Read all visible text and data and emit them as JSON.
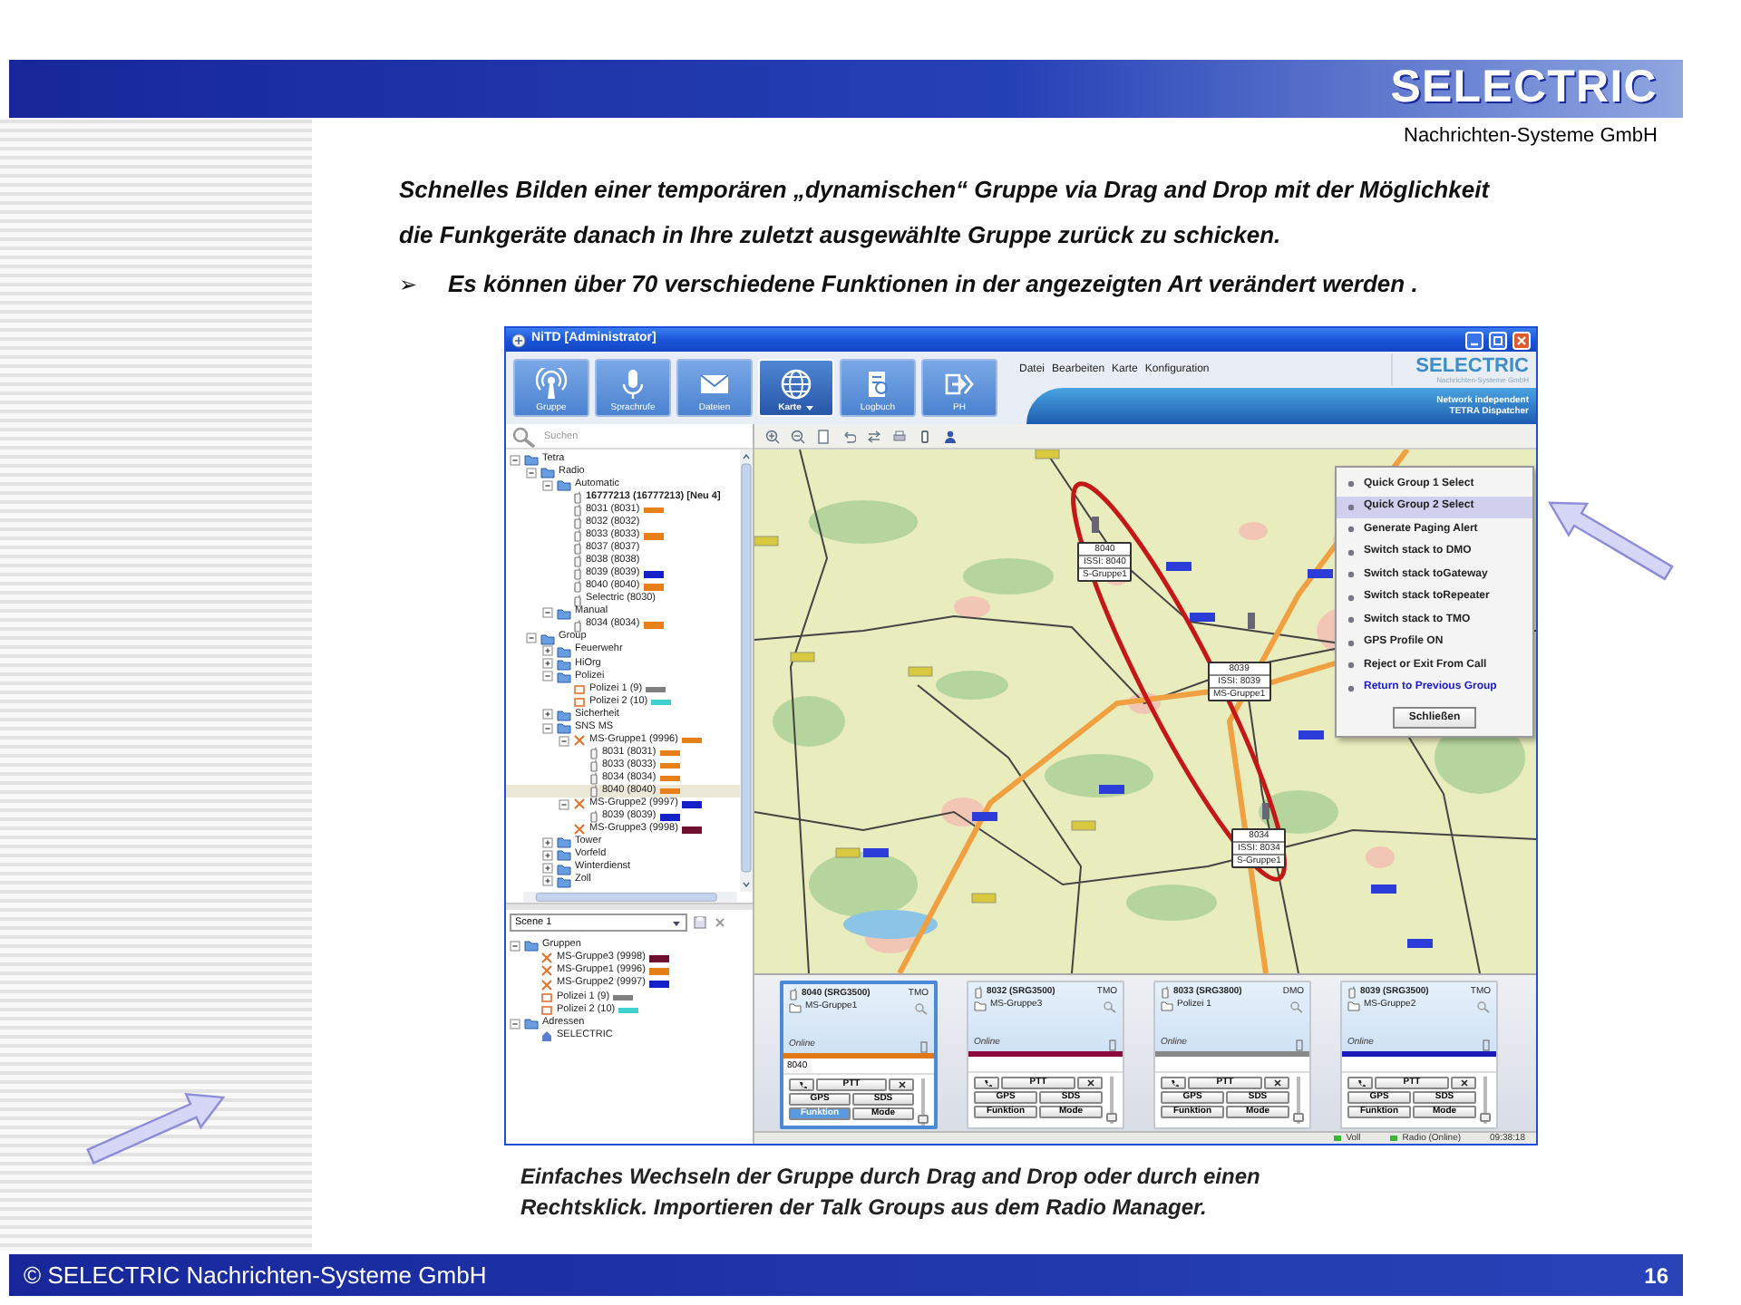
{
  "header": {
    "logo": "SELECTRIC",
    "tagline": "Nachrichten-Systeme GmbH"
  },
  "intro": {
    "lines": [
      "Schnelles Bilden einer temporären „dynamischen“ Gruppe via Drag and Drop mit der Möglichkeit",
      "die Funkgeräte danach in Ihre zuletzt ausgewählte Gruppe zurück zu schicken."
    ]
  },
  "bullet": {
    "marker": "➢",
    "text": "Es können über 70 verschiedene Funktionen in der angezeigten Art verändert werden ."
  },
  "app": {
    "title": "NiTD [Administrator]",
    "toolbar": [
      {
        "kind": "group",
        "label": "Gruppe",
        "selected": false,
        "has_menu": false
      },
      {
        "kind": "voice",
        "label": "Sprachrufe",
        "selected": false,
        "has_menu": false
      },
      {
        "kind": "files",
        "label": "Dateien",
        "selected": false,
        "has_menu": false
      },
      {
        "kind": "map",
        "label": "Karte",
        "selected": true,
        "has_menu": true
      },
      {
        "kind": "log",
        "label": "Logbuch",
        "selected": false,
        "has_menu": false
      },
      {
        "kind": "ph",
        "label": "PH",
        "selected": false,
        "has_menu": false
      }
    ],
    "menu": [
      "Datei",
      "Bearbeiten",
      "Karte",
      "Konfiguration"
    ],
    "logo": {
      "name": "SELECTRIC",
      "subtitle": "Nachrichten-Systeme GmbH",
      "tagline": [
        "Network independent",
        "TETRA Dispatcher"
      ]
    },
    "search": {
      "placeholder": "Suchen"
    },
    "tree": [
      {
        "kind": "folder",
        "label": "Tetra",
        "expanded": true,
        "selected": false,
        "children": [
          {
            "kind": "folder",
            "label": "Radio",
            "expanded": true,
            "selected": false,
            "children": [
              {
                "kind": "folder",
                "label": "Automatic",
                "expanded": true,
                "selected": false,
                "children": [
                  {
                    "kind": "radio",
                    "label": "16777213 (16777213) [Neu 4]",
                    "bold": true,
                    "selected": false
                  },
                  {
                    "kind": "radio",
                    "label": "8031 (8031)",
                    "color": "#e8801a",
                    "selected": false
                  },
                  {
                    "kind": "radio",
                    "label": "8032 (8032)",
                    "selected": false
                  },
                  {
                    "kind": "radio",
                    "label": "8033 (8033)",
                    "color": "#e8801a",
                    "selected": false
                  },
                  {
                    "kind": "radio",
                    "label": "8037 (8037)",
                    "selected": false
                  },
                  {
                    "kind": "radio",
                    "label": "8038 (8038)",
                    "selected": false
                  },
                  {
                    "kind": "radio",
                    "label": "8039 (8039)",
                    "color": "#1420c8",
                    "selected": false
                  },
                  {
                    "kind": "radio",
                    "label": "8040 (8040)",
                    "color": "#e8801a",
                    "selected": false
                  },
                  {
                    "kind": "radio",
                    "label": "Selectric (8030)",
                    "selected": false
                  }
                ]
              },
              {
                "kind": "folder",
                "label": "Manual",
                "expanded": true,
                "selected": false,
                "children": [
                  {
                    "kind": "radio",
                    "label": "8034 (8034)",
                    "color": "#e8801a",
                    "selected": false
                  }
                ]
              }
            ]
          },
          {
            "kind": "folder",
            "label": "Group",
            "expanded": true,
            "selected": false,
            "children": [
              {
                "kind": "folder",
                "label": "Feuerwehr",
                "expanded": false,
                "selected": false
              },
              {
                "kind": "folder",
                "label": "HiOrg",
                "expanded": false,
                "selected": false
              },
              {
                "kind": "folder",
                "label": "Polizei",
                "expanded": true,
                "selected": false,
                "children": [
                  {
                    "kind": "talkgroup",
                    "label": "Polizei 1 (9)",
                    "color": "#808080",
                    "selected": false
                  },
                  {
                    "kind": "talkgroup",
                    "label": "Polizei 2 (10)",
                    "color": "#40d0d0",
                    "selected": false
                  }
                ]
              },
              {
                "kind": "folder",
                "label": "Sicherheit",
                "expanded": false,
                "selected": false
              },
              {
                "kind": "folder",
                "label": "SNS MS",
                "expanded": true,
                "selected": false,
                "children": [
                  {
                    "kind": "group",
                    "label": "MS-Gruppe1 (9996)",
                    "color": "#e8801a",
                    "expanded": true,
                    "selected": false,
                    "children": [
                      {
                        "kind": "radio",
                        "label": "8031 (8031)",
                        "color": "#e8801a",
                        "selected": false
                      },
                      {
                        "kind": "radio",
                        "label": "8033 (8033)",
                        "color": "#e8801a",
                        "selected": false
                      },
                      {
                        "kind": "radio",
                        "label": "8034 (8034)",
                        "color": "#e8801a",
                        "selected": false
                      },
                      {
                        "kind": "radio",
                        "label": "8040 (8040)",
                        "color": "#e8801a",
                        "selected": true
                      }
                    ]
                  },
                  {
                    "kind": "group",
                    "label": "MS-Gruppe2 (9997)",
                    "color": "#1420c8",
                    "expanded": true,
                    "selected": false,
                    "children": [
                      {
                        "kind": "radio",
                        "label": "8039 (8039)",
                        "color": "#1420c8",
                        "selected": false
                      }
                    ]
                  },
                  {
                    "kind": "group",
                    "label": "MS-Gruppe3 (9998)",
                    "color": "#701030",
                    "selected": false
                  }
                ]
              },
              {
                "kind": "folder",
                "label": "Tower",
                "expanded": false,
                "selected": false
              },
              {
                "kind": "folder",
                "label": "Vorfeld",
                "expanded": false,
                "selected": false
              },
              {
                "kind": "folder",
                "label": "Winterdienst",
                "expanded": false,
                "selected": false
              },
              {
                "kind": "folder",
                "label": "Zoll",
                "expanded": false,
                "selected": false
              }
            ]
          }
        ]
      }
    ],
    "scene": {
      "value": "Scene 1"
    },
    "scene_tree": [
      {
        "kind": "folder",
        "label": "Gruppen",
        "expanded": true,
        "selected": false,
        "children": [
          {
            "kind": "group",
            "label": "MS-Gruppe3 (9998)",
            "color": "#701030",
            "selected": false
          },
          {
            "kind": "group",
            "label": "MS-Gruppe1 (9996)",
            "color": "#e8801a",
            "selected": false
          },
          {
            "kind": "group",
            "label": "MS-Gruppe2 (9997)",
            "color": "#1420c8",
            "selected": false
          },
          {
            "kind": "talkgroup",
            "label": "Polizei 1 (9)",
            "color": "#808080",
            "selected": false
          },
          {
            "kind": "talkgroup",
            "label": "Polizei 2 (10)",
            "color": "#40d0d0",
            "selected": false
          }
        ]
      },
      {
        "kind": "folder",
        "label": "Adressen",
        "expanded": true,
        "selected": false,
        "children": [
          {
            "kind": "address",
            "label": "SELECTRIC",
            "selected": false
          }
        ]
      }
    ],
    "map": {
      "markers": [
        {
          "lines": [
            "8040",
            "ISSI: 8040",
            "S-Gruppe1"
          ]
        },
        {
          "lines": [
            "8039",
            "ISSI: 8039",
            "MS-Gruppe1"
          ]
        },
        {
          "lines": [
            "8034",
            "ISSI: 8034",
            "S-Gruppe1"
          ]
        }
      ]
    },
    "context_menu": {
      "items": [
        {
          "kind": "command",
          "label": "Quick Group 1 Select",
          "selected": false
        },
        {
          "kind": "command",
          "label": "Quick Group 2 Select",
          "selected": true
        },
        {
          "kind": "command",
          "label": "Generate Paging Alert",
          "selected": false
        },
        {
          "kind": "command",
          "label": "Switch stack to DMO",
          "selected": false
        },
        {
          "kind": "command",
          "label": "Switch stack toGateway",
          "selected": false
        },
        {
          "kind": "command",
          "label": "Switch stack toRepeater",
          "selected": false
        },
        {
          "kind": "command",
          "label": "Switch stack to TMO",
          "selected": false
        },
        {
          "kind": "command",
          "label": "GPS Profile ON",
          "selected": false
        },
        {
          "kind": "command",
          "label": "Reject or Exit From Call",
          "selected": false
        },
        {
          "kind": "return",
          "label": "Return to Previous Group",
          "selected": false
        }
      ],
      "close_button": "Schließen"
    },
    "cards": [
      {
        "title": "8040 (SRG3500)",
        "mode": "TMO",
        "group": "MS-Gruppe1",
        "status": "Online",
        "color": "#e07818",
        "value": "8040",
        "selected": true,
        "buttons": [
          {
            "label": "PTT",
            "active": false
          },
          {
            "label": "GPS",
            "active": false
          },
          {
            "label": "SDS",
            "active": false
          },
          {
            "label": "Funktion",
            "active": true
          },
          {
            "label": "Mode",
            "active": false
          }
        ],
        "volume": {
          "level": 0.05
        }
      },
      {
        "title": "8032 (SRG3500)",
        "mode": "TMO",
        "group": "MS-Gruppe3",
        "status": "Online",
        "color": "#8b0a3a",
        "selected": false,
        "buttons": [
          {
            "label": "PTT",
            "active": false
          },
          {
            "label": "GPS",
            "active": false
          },
          {
            "label": "SDS",
            "active": false
          },
          {
            "label": "Funktion",
            "active": false
          },
          {
            "label": "Mode",
            "active": false
          }
        ],
        "volume": {
          "level": 0.05
        }
      },
      {
        "title": "8033 (SRG3800)",
        "mode": "DMO",
        "group": "Polizei 1",
        "status": "Online",
        "color": "#888888",
        "selected": false,
        "buttons": [
          {
            "label": "PTT",
            "active": false
          },
          {
            "label": "GPS",
            "active": false
          },
          {
            "label": "SDS",
            "active": false
          },
          {
            "label": "Funktion",
            "active": false
          },
          {
            "label": "Mode",
            "active": false
          }
        ],
        "volume": {
          "level": 0.05
        }
      },
      {
        "title": "8039 (SRG3500)",
        "mode": "TMO",
        "group": "MS-Gruppe2",
        "status": "Online",
        "color": "#1a1ab8",
        "selected": false,
        "buttons": [
          {
            "label": "PTT",
            "active": false
          },
          {
            "label": "GPS",
            "active": false
          },
          {
            "label": "SDS",
            "active": false
          },
          {
            "label": "Funktion",
            "active": false
          },
          {
            "label": "Mode",
            "active": false
          }
        ],
        "volume": {
          "level": 0.05
        }
      }
    ],
    "status_bar": [
      {
        "kind": "indicator",
        "text": "Voll"
      },
      {
        "kind": "indicator",
        "text": "Radio (Online)"
      },
      {
        "kind": "clock",
        "text": "09:38:18"
      }
    ]
  },
  "caption": {
    "lines": [
      "Einfaches Wechseln der Gruppe durch Drag and Drop oder durch einen",
      "Rechtsklick. Importieren der Talk Groups aus dem Radio Manager."
    ]
  },
  "footer": {
    "copyright": "© SELECTRIC Nachrichten-Systeme GmbH",
    "page": "16"
  }
}
